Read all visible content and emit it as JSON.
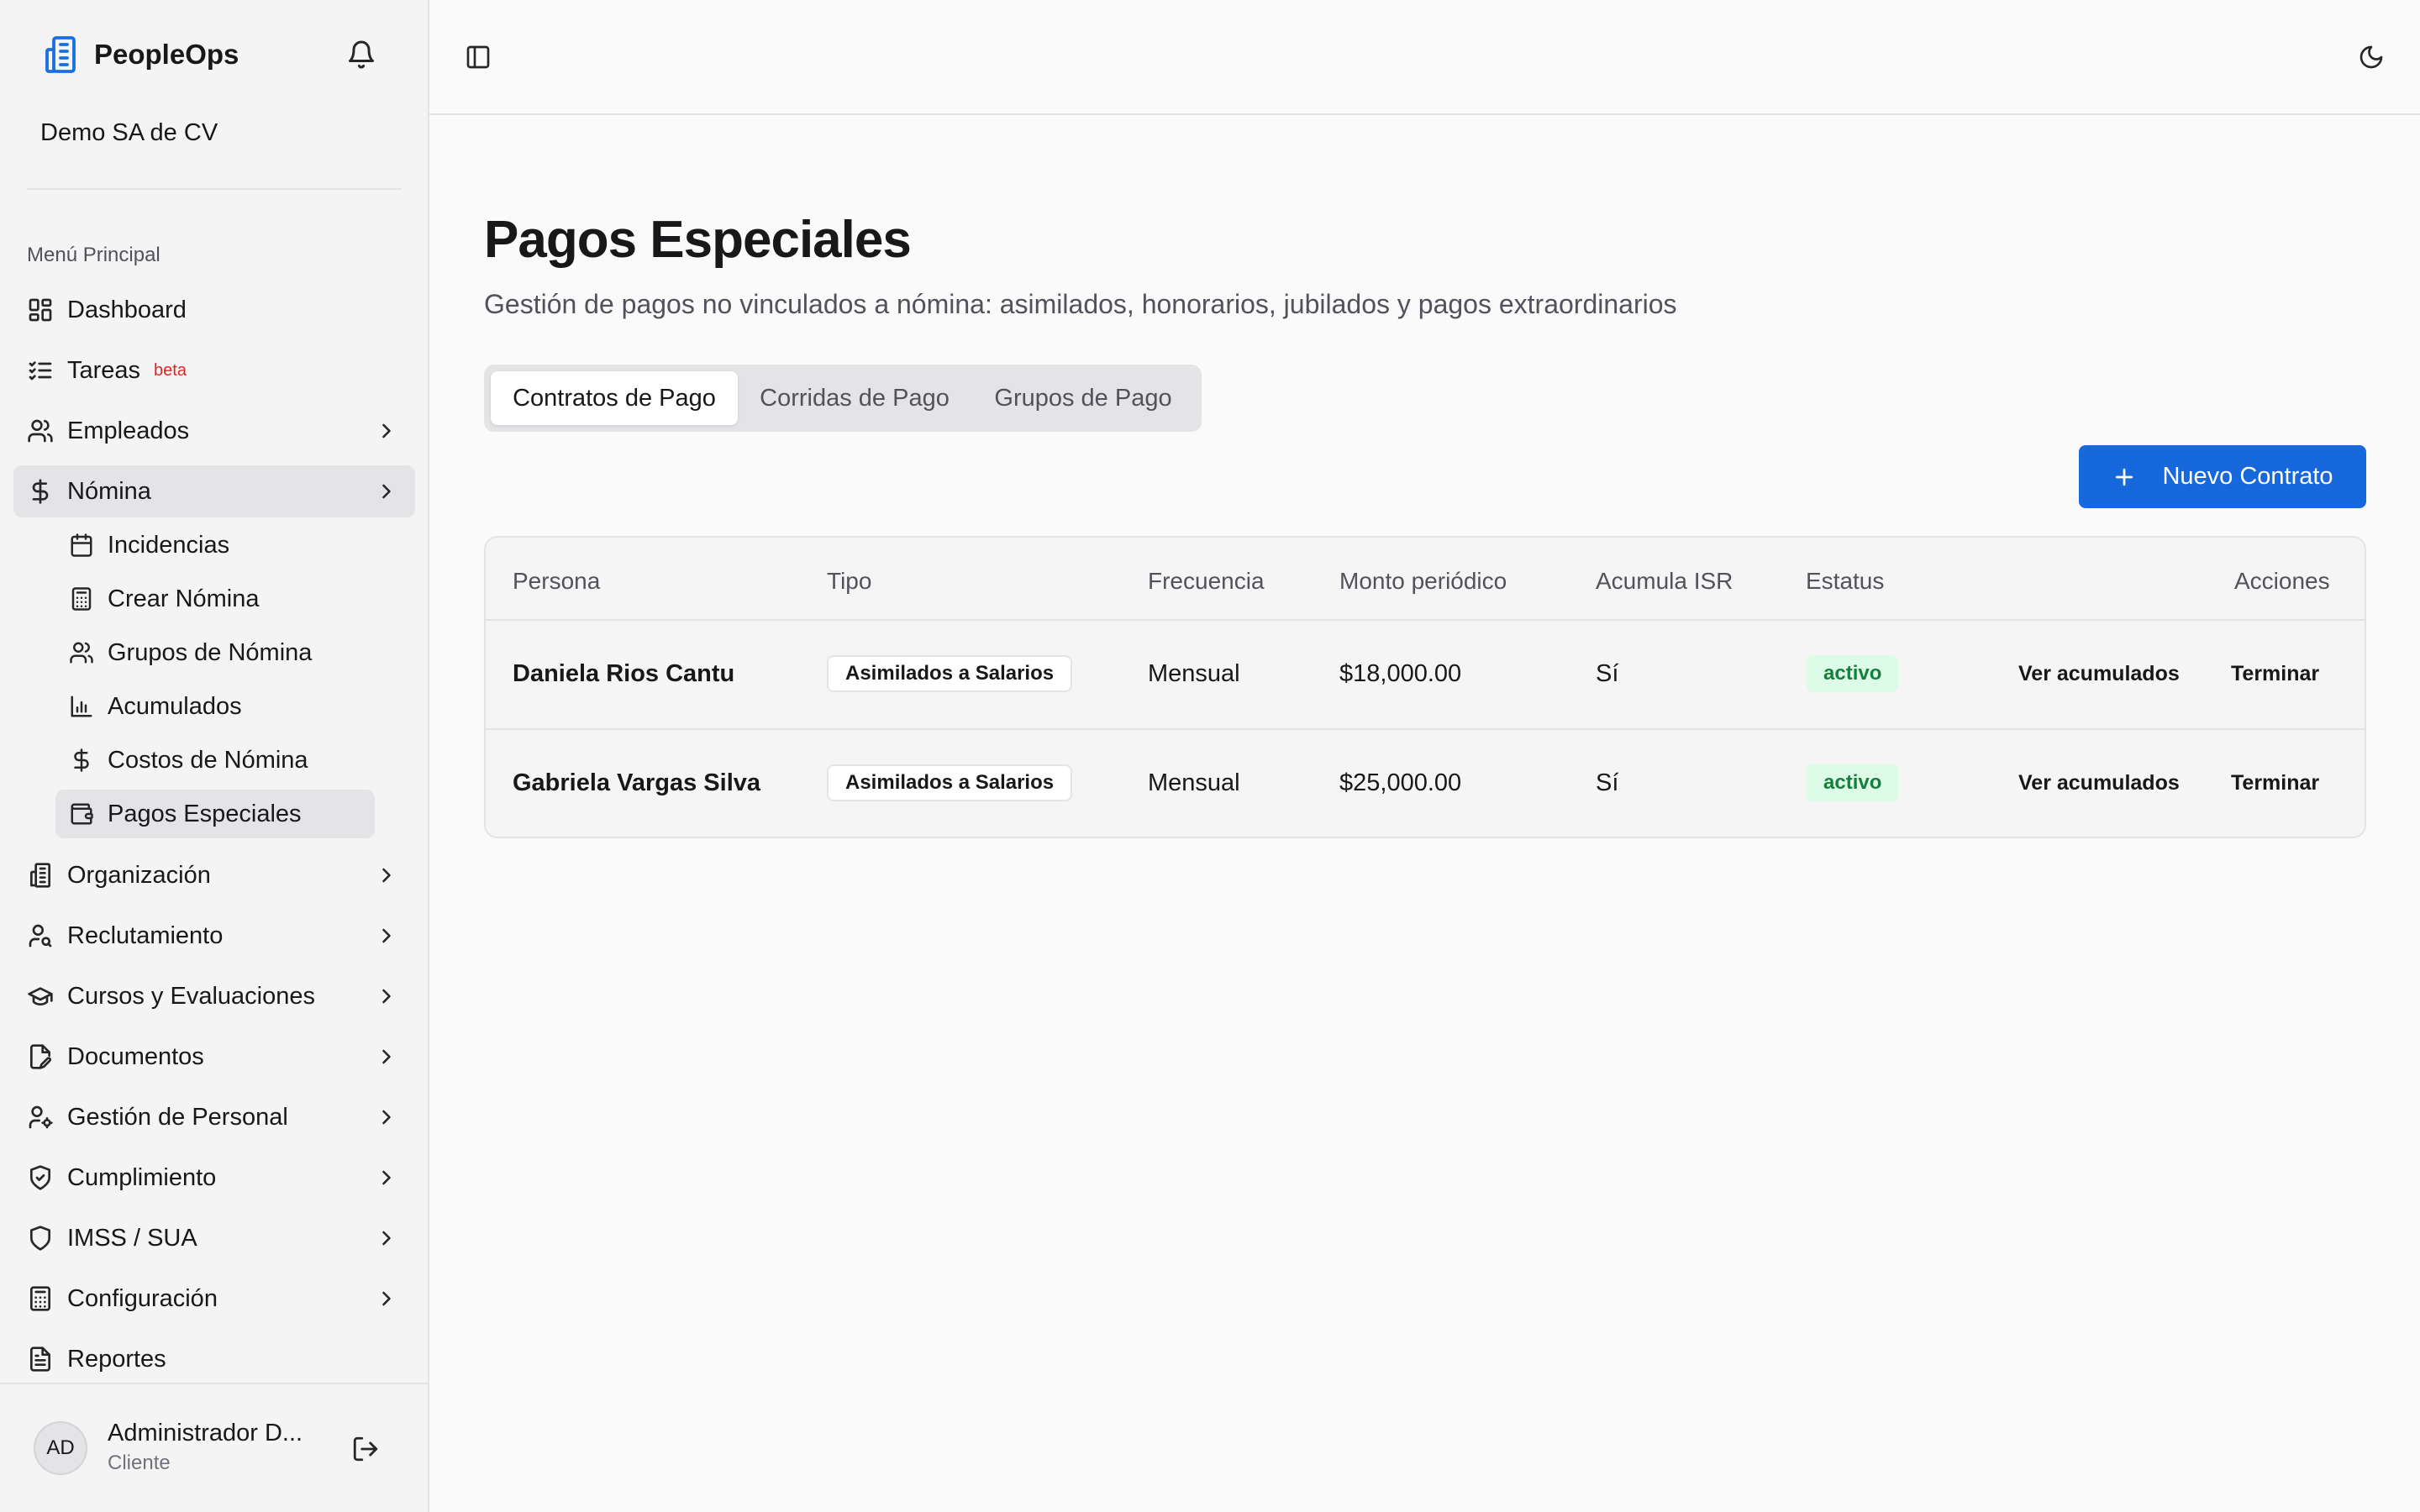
{
  "sidebar": {
    "brand": "PeopleOps",
    "company": "Demo SA de CV",
    "section_label": "Menú Principal",
    "items": [
      {
        "label": "Dashboard"
      },
      {
        "label": "Tareas",
        "badge": "beta"
      },
      {
        "label": "Empleados"
      },
      {
        "label": "Nómina"
      },
      {
        "label": "Organización"
      },
      {
        "label": "Reclutamiento"
      },
      {
        "label": "Cursos y Evaluaciones"
      },
      {
        "label": "Documentos"
      },
      {
        "label": "Gestión de Personal"
      },
      {
        "label": "Cumplimiento"
      },
      {
        "label": "IMSS / SUA"
      },
      {
        "label": "Configuración"
      },
      {
        "label": "Reportes"
      }
    ],
    "nomina_sub": [
      {
        "label": "Incidencias"
      },
      {
        "label": "Crear Nómina"
      },
      {
        "label": "Grupos de Nómina"
      },
      {
        "label": "Acumulados"
      },
      {
        "label": "Costos de Nómina"
      },
      {
        "label": "Pagos Especiales"
      }
    ],
    "user": {
      "initials": "AD",
      "name": "Administrador D...",
      "role": "Cliente"
    }
  },
  "main": {
    "title": "Pagos Especiales",
    "subtitle": "Gestión de pagos no vinculados a nómina: asimilados, honorarios, jubilados y pagos extraordinarios",
    "tabs": [
      "Contratos de Pago",
      "Corridas de Pago",
      "Grupos de Pago"
    ],
    "new_button": "Nuevo Contrato"
  },
  "table": {
    "headers": [
      "Persona",
      "Tipo",
      "Frecuencia",
      "Monto periódico",
      "Acumula ISR",
      "Estatus",
      "Acciones"
    ],
    "rows": [
      {
        "persona": "Daniela Rios Cantu",
        "tipo": "Asimilados a Salarios",
        "frecuencia": "Mensual",
        "monto": "$18,000.00",
        "isr": "Sí",
        "estatus": "activo",
        "action1": "Ver acumulados",
        "action2": "Terminar"
      },
      {
        "persona": "Gabriela Vargas Silva",
        "tipo": "Asimilados a Salarios",
        "frecuencia": "Mensual",
        "monto": "$25,000.00",
        "isr": "Sí",
        "estatus": "activo",
        "action1": "Ver acumulados",
        "action2": "Terminar"
      }
    ]
  },
  "colors": {
    "accent": "#1668dc",
    "active_status_bg": "#dcfce7",
    "active_status_text": "#15803d",
    "beta": "#dc2626"
  }
}
